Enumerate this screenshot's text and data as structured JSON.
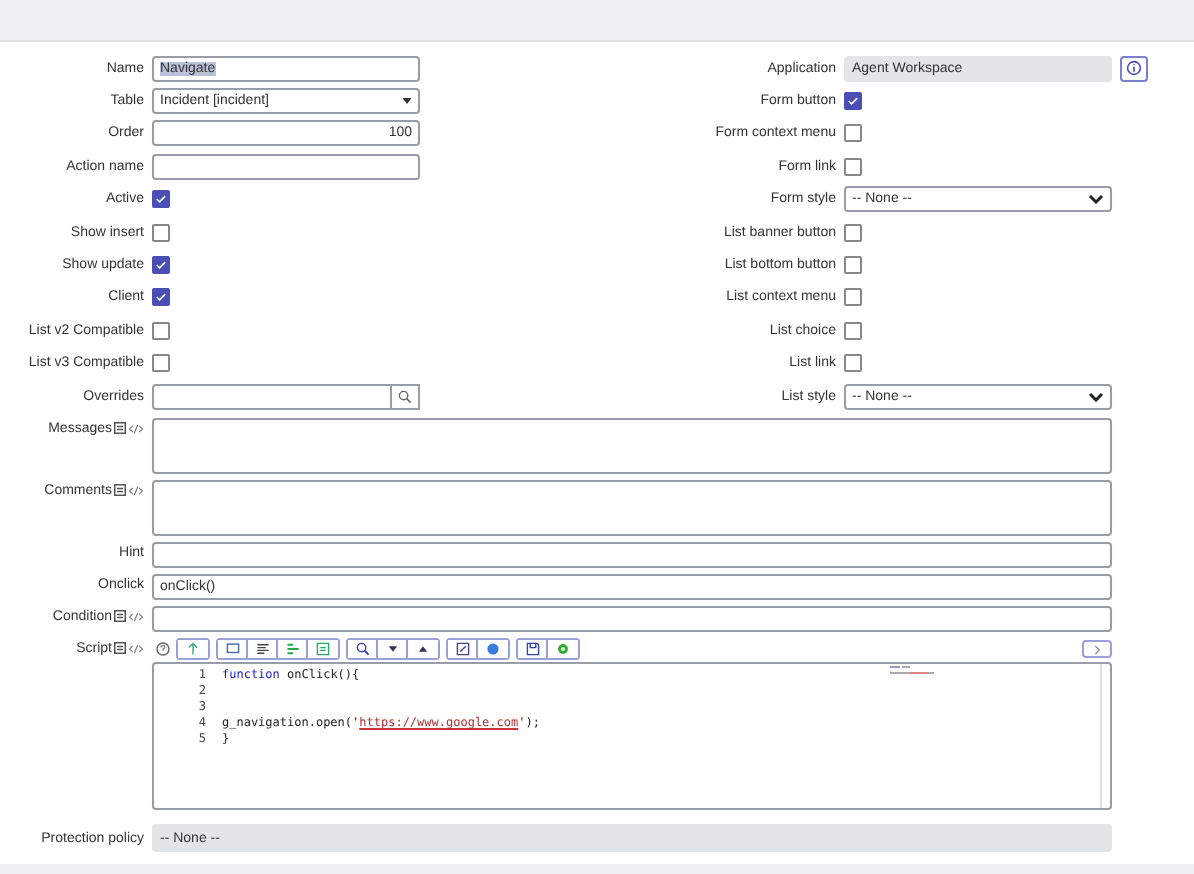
{
  "left_fields": [
    {
      "label": "Name",
      "kind": "text",
      "value": "Navigate",
      "highlighted": true
    },
    {
      "label": "Table",
      "kind": "select",
      "value": "Incident [incident]"
    },
    {
      "label": "Order",
      "kind": "number",
      "value": "100"
    },
    {
      "label": "Action name",
      "kind": "text"
    },
    {
      "label": "Active",
      "kind": "checkbox",
      "checked": true
    },
    {
      "label": "Show insert",
      "kind": "checkbox",
      "checked": false
    },
    {
      "label": "Show update",
      "kind": "checkbox",
      "checked": true
    },
    {
      "label": "Client",
      "kind": "checkbox",
      "checked": true
    },
    {
      "label": "List v2 Compatible",
      "kind": "checkbox",
      "checked": false
    },
    {
      "label": "List v3 Compatible",
      "kind": "checkbox",
      "checked": false
    },
    {
      "label": "Overrides",
      "kind": "reference"
    }
  ],
  "right_fields": [
    {
      "label": "Application",
      "kind": "readonly",
      "value": "Agent Workspace"
    },
    {
      "label": "Form button",
      "kind": "checkbox",
      "checked": true
    },
    {
      "label": "Form context menu",
      "kind": "checkbox",
      "checked": false
    },
    {
      "label": "Form link",
      "kind": "checkbox",
      "checked": false
    },
    {
      "label": "Form style",
      "kind": "dropdown",
      "value": "-- None --"
    },
    {
      "label": "List banner button",
      "kind": "checkbox",
      "checked": false
    },
    {
      "label": "List bottom button",
      "kind": "checkbox",
      "checked": false
    },
    {
      "label": "List context menu",
      "kind": "checkbox",
      "checked": false
    },
    {
      "label": "List choice",
      "kind": "checkbox",
      "checked": false
    },
    {
      "label": "List link",
      "kind": "checkbox",
      "checked": false
    },
    {
      "label": "List style",
      "kind": "dropdown",
      "value": "-- None --"
    }
  ],
  "wide_fields": [
    {
      "label": "Messages",
      "kind": "textarea",
      "translatable": true
    },
    {
      "label": "Comments",
      "kind": "textarea",
      "translatable": true
    },
    {
      "label": "Hint",
      "kind": "text",
      "translatable": false
    },
    {
      "label": "Onclick",
      "kind": "text",
      "value": "onClick()",
      "translatable": false
    },
    {
      "label": "Condition",
      "kind": "text",
      "translatable": true
    }
  ],
  "script": {
    "label": "Script",
    "lines": [
      {
        "number": "1",
        "tokens": [
          {
            "kind": "keyword",
            "text": "function"
          },
          {
            "kind": "plain",
            "text": " onClick(){"
          }
        ]
      },
      {
        "number": "2"
      },
      {
        "number": "3"
      },
      {
        "number": "4",
        "tokens": [
          {
            "kind": "plain",
            "text": "g_navigation.open('"
          },
          {
            "kind": "url",
            "text": "https://www.google.com"
          },
          {
            "kind": "plain",
            "text": "');"
          }
        ]
      },
      {
        "number": "5",
        "tokens": [
          {
            "kind": "plain",
            "text": "}"
          }
        ]
      }
    ]
  },
  "protection_policy": {
    "label": "Protection policy",
    "value": "-- None --"
  }
}
